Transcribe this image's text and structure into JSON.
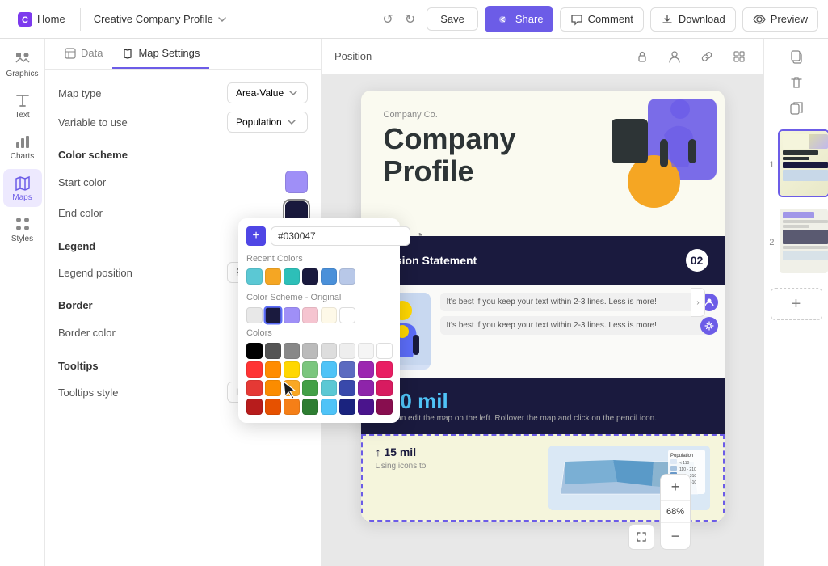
{
  "topbar": {
    "home_label": "Home",
    "doc_title": "Creative Company Profile",
    "save_label": "Save",
    "share_label": "Share",
    "comment_label": "Comment",
    "download_label": "Download",
    "preview_label": "Preview"
  },
  "sidebar": {
    "items": [
      {
        "id": "graphics",
        "label": "Graphics",
        "icon": "graphics-icon"
      },
      {
        "id": "text",
        "label": "Text",
        "icon": "text-icon"
      },
      {
        "id": "charts",
        "label": "Charts",
        "icon": "charts-icon"
      },
      {
        "id": "maps",
        "label": "Maps",
        "icon": "maps-icon",
        "active": true
      },
      {
        "id": "styles",
        "label": "Styles",
        "icon": "styles-icon"
      }
    ]
  },
  "left_panel": {
    "tabs": [
      {
        "id": "data",
        "label": "Data",
        "active": false
      },
      {
        "id": "map_settings",
        "label": "Map Settings",
        "active": true
      }
    ],
    "map_type": {
      "label": "Map type",
      "value": "Area-Value"
    },
    "variable_to_use": {
      "label": "Variable to use",
      "value": "Population"
    },
    "color_scheme": {
      "title": "Color scheme",
      "start_color_label": "Start color",
      "start_color": "#9f8ff7",
      "end_color_label": "End color",
      "end_color": "#1a1a3e"
    },
    "legend": {
      "title": "Legend",
      "position_label": "Legend position",
      "position_value": "Right"
    },
    "border": {
      "title": "Border",
      "color_label": "Border color"
    },
    "tooltips": {
      "title": "Tooltips",
      "style_label": "Tooltips style",
      "style_value": "Light"
    }
  },
  "color_picker": {
    "hex_value": "#030047",
    "section_original": "Color Scheme - Original",
    "section_colors": "Colors",
    "section_recent": "Recent Colors",
    "recent_colors": [
      "#5bc8d4",
      "#f5a623",
      "#2dbfb8",
      "#1a1a3e",
      "#4a90d9",
      "#b8c8e8"
    ],
    "original_colors": [
      "#e8e8e8",
      "#1a1a3e",
      "#9f8ff7",
      "#f5c4d0",
      "#fef9e8",
      "#ffffff"
    ],
    "palette": [
      "#000000",
      "#555555",
      "#888888",
      "#bbbbbb",
      "#dddddd",
      "#eeeeee",
      "#f5f5f5",
      "#ffffff",
      "#ff3333",
      "#ff8c00",
      "#ffd700",
      "#7bc67e",
      "#4fc3f7",
      "#5c6bc0",
      "#9c27b0",
      "#e91e63",
      "#e53935",
      "#fb8c00",
      "#f9a825",
      "#43a047",
      "#039be5",
      "#3949ab",
      "#8e24aa",
      "#d81b60",
      "#b71c1c",
      "#e65100",
      "#f57f17",
      "#2e7d32",
      "#01579b",
      "#1a237e",
      "#4a148c",
      "#880e4f"
    ]
  },
  "canvas": {
    "toolbar": {
      "position_label": "Position"
    },
    "zoom_label": "68%",
    "design": {
      "company_label": "Company Co.",
      "title_line1": "Company",
      "title_line2": "Profile",
      "mission_title": "Mission Statement",
      "mission_num": "02",
      "mission_text1": "It's best if you keep your text within 2-3 lines. Less is more!",
      "mission_text2": "It's best if you keep your text within 2-3 lines. Less is more!",
      "stat1": "$10 mil",
      "stat1_desc": "You can edit the map on the left. Rollover the map and click on the pencil icon.",
      "stat2": "↑ 15 mil",
      "stat2_desc": "Using icons to"
    }
  },
  "right_panel": {
    "pages": [
      {
        "num": "1",
        "active": true
      },
      {
        "num": "2",
        "active": false
      }
    ],
    "add_page_label": "+"
  }
}
